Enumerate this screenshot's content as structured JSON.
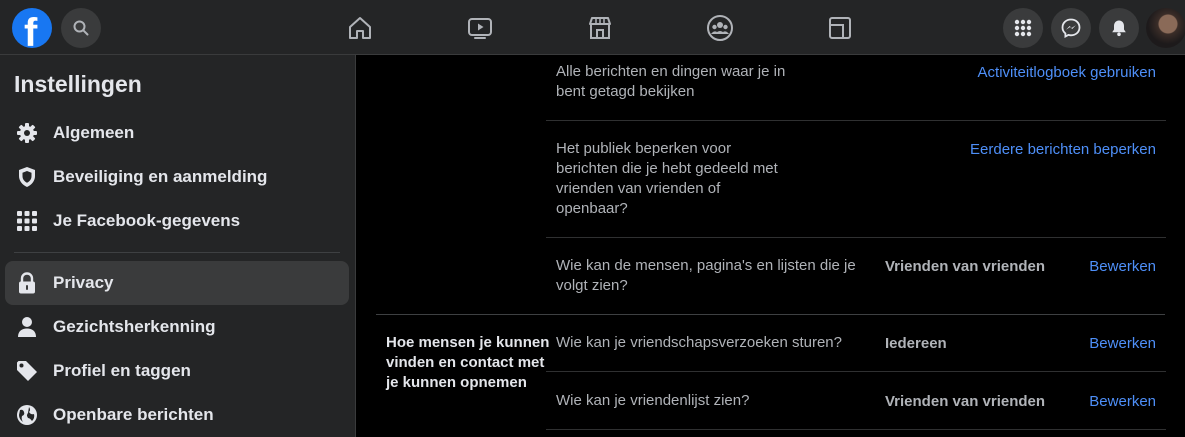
{
  "topbar": {
    "logo_letter": "f",
    "nav": [
      {
        "name": "home-icon"
      },
      {
        "name": "watch-icon"
      },
      {
        "name": "marketplace-icon"
      },
      {
        "name": "groups-icon"
      },
      {
        "name": "gaming-icon"
      }
    ],
    "actions": [
      "menu-grid-icon",
      "messenger-icon",
      "notifications-icon",
      "profile-avatar"
    ]
  },
  "sidebar": {
    "title": "Instellingen",
    "items": [
      {
        "label": "Algemeen",
        "icon": "gear-icon"
      },
      {
        "label": "Beveiliging en aanmelding",
        "icon": "shield-icon"
      },
      {
        "label": "Je Facebook-gegevens",
        "icon": "grid-icon"
      },
      {
        "label": "Privacy",
        "icon": "lock-icon",
        "active": true
      },
      {
        "label": "Gezichtsherkenning",
        "icon": "person-icon"
      },
      {
        "label": "Profiel en taggen",
        "icon": "tag-icon"
      },
      {
        "label": "Openbare berichten",
        "icon": "globe-icon"
      }
    ]
  },
  "main": {
    "rows": [
      {
        "question": "Alle berichten en dingen waar je in bent getagd bekijken",
        "value": "",
        "link": "Activiteitlogboek gebruiken"
      },
      {
        "question": "Het publiek beperken voor berichten die je hebt gedeeld met vrienden van vrienden of openbaar?",
        "value": "",
        "link": "Eerdere berichten beperken"
      },
      {
        "question": "Wie kan de mensen, pagina's en lijsten die je volgt zien?",
        "value": "Vrienden van vrienden",
        "link": "Bewerken"
      },
      {
        "question": "Wie kan je vriendschapsverzoeken sturen?",
        "value": "Iedereen",
        "link": "Bewerken"
      },
      {
        "question": "Wie kan je vriendenlijst zien?",
        "value": "Vrienden van vrienden",
        "link": "Bewerken"
      }
    ],
    "section_title": "Hoe mensen je kunnen vinden en contact met je kunnen opnemen"
  },
  "colors": {
    "accent": "#1877f2",
    "link": "#4e8ff8",
    "panel": "#242526",
    "background": "#000000"
  }
}
